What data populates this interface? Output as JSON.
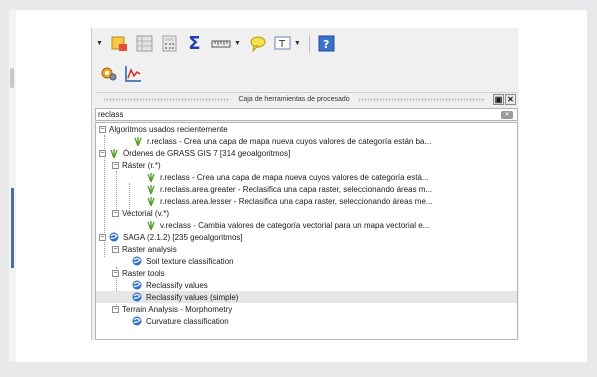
{
  "panel": {
    "title": "Caja de herramientas de procesado",
    "float_button": "▣",
    "close_button": "✕"
  },
  "search": {
    "value": "reclass"
  },
  "toolbar": {
    "sum_symbol": "Σ"
  },
  "tree": {
    "recent": {
      "label": "Algoritmos usados recientemente",
      "items": [
        "r.reclass - Crea una capa de mapa nueva cuyos valores de categoría están ba..."
      ]
    },
    "grass": {
      "label": "Órdenes de GRASS GIS 7 [314 geoalgoritmos]",
      "raster": {
        "label": "Ráster (r.*)",
        "items": [
          "r.reclass - Crea una capa de mapa nueva cuyos valores de categoría está...",
          "r.reclass.area.greater - Reclasifica una capa raster, seleccionando áreas m...",
          "r.reclass.area.lesser - Reclasifica una capa raster, seleccionando áreas me..."
        ]
      },
      "vectorial": {
        "label": "Vectorial (v.*)",
        "items": [
          "v.reclass - Cambia valores de categoría vectorial para un mapa vectorial e..."
        ]
      }
    },
    "saga": {
      "label": "SAGA (2.1.2) [235 geoalgoritmos]",
      "raster_analysis": {
        "label": "Raster analysis",
        "items": [
          "Soil texture classification"
        ]
      },
      "raster_tools": {
        "label": "Raster tools",
        "items": [
          "Reclassify values",
          "Reclassify values (simple)"
        ]
      },
      "terrain": {
        "label": "Terrain Analysis - Morphometry",
        "items": [
          "Curvature classification"
        ]
      }
    }
  }
}
